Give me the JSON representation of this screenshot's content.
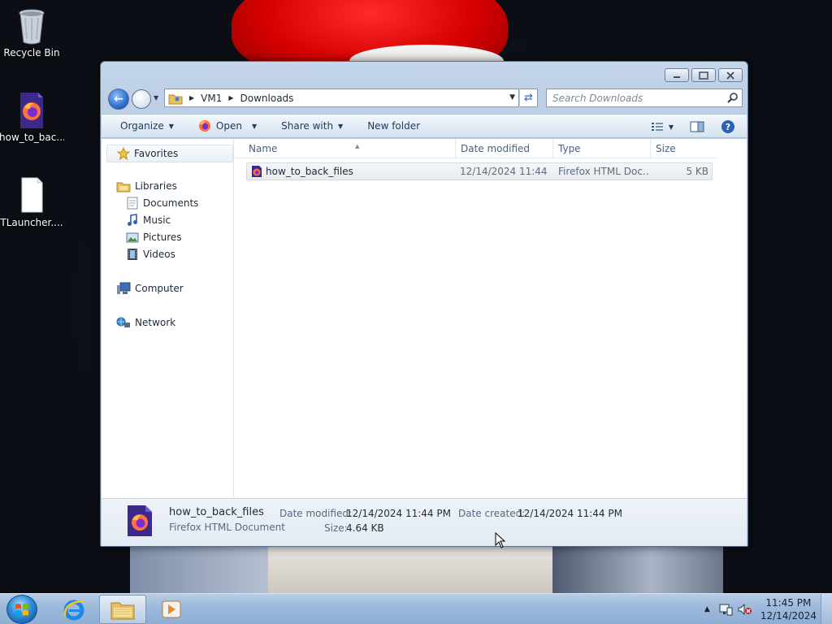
{
  "desktop": {
    "icons": [
      {
        "label": "Recycle Bin",
        "icon": "recycle-bin-icon"
      },
      {
        "label": "how_to_bac...",
        "icon": "firefox-document-icon"
      },
      {
        "label": "TLauncher....",
        "icon": "blank-file-icon"
      }
    ]
  },
  "window": {
    "caption": {
      "minimize": "minimize-icon",
      "maximize": "maximize-icon",
      "close": "close-icon"
    },
    "breadcrumb": [
      "VM1",
      "Downloads"
    ],
    "search_placeholder": "Search Downloads",
    "toolbar": {
      "organize": "Organize",
      "open": "Open",
      "share_with": "Share with",
      "new_folder": "New folder"
    },
    "nav": {
      "favorites": "Favorites",
      "libraries": "Libraries",
      "documents": "Documents",
      "music": "Music",
      "pictures": "Pictures",
      "videos": "Videos",
      "computer": "Computer",
      "network": "Network"
    },
    "columns": {
      "name": "Name",
      "date_modified": "Date modified",
      "type": "Type",
      "size": "Size"
    },
    "files": [
      {
        "name": "how_to_back_files",
        "date_modified": "12/14/2024 11:44 ...",
        "type": "Firefox HTML Doc...",
        "size": "5 KB"
      }
    ],
    "details": {
      "name": "how_to_back_files",
      "type": "Firefox HTML Document",
      "date_modified_label": "Date modified:",
      "date_modified": "12/14/2024 11:44 PM",
      "date_created_label": "Date created:",
      "date_created": "12/14/2024 11:44 PM",
      "size_label": "Size:",
      "size": "4.64 KB"
    }
  },
  "taskbar": {
    "clock_time": "11:45 PM",
    "clock_date": "12/14/2024"
  },
  "colors": {
    "accent": "#2f6fcf",
    "firefox_orange": "#ff7139",
    "firefox_purple": "#7a2dd6"
  }
}
